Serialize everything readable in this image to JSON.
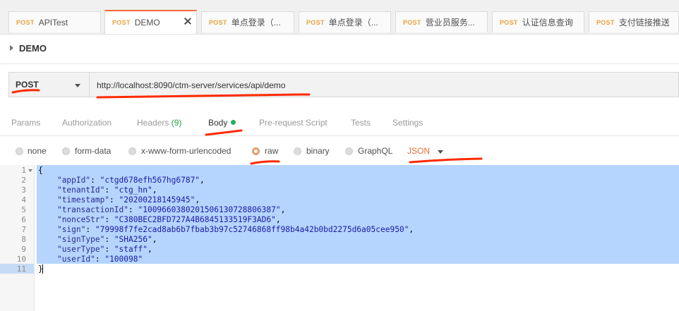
{
  "request_tabs": [
    {
      "method": "POST",
      "name": "APITest",
      "active": false
    },
    {
      "method": "POST",
      "name": "DEMO",
      "active": true
    },
    {
      "method": "POST",
      "name": "单点登录（...",
      "active": false
    },
    {
      "method": "POST",
      "name": "单点登录（...",
      "active": false
    },
    {
      "method": "POST",
      "name": "营业员服务...",
      "active": false
    },
    {
      "method": "POST",
      "name": "认证信息查询",
      "active": false
    },
    {
      "method": "POST",
      "name": "支付链接推送",
      "active": false
    }
  ],
  "breadcrumb": {
    "title": "DEMO"
  },
  "request": {
    "method": "POST",
    "url": "http://localhost:8090/ctm-server/services/api/demo"
  },
  "request_sub_tabs": [
    {
      "label": "Params"
    },
    {
      "label": "Authorization"
    },
    {
      "label": "Headers",
      "count": "(9)"
    },
    {
      "label": "Body",
      "active": true
    },
    {
      "label": "Pre-request Script"
    },
    {
      "label": "Tests"
    },
    {
      "label": "Settings"
    }
  ],
  "body_modes": [
    {
      "label": "none",
      "selected": false
    },
    {
      "label": "form-data",
      "selected": false
    },
    {
      "label": "x-www-form-urlencoded",
      "selected": false
    },
    {
      "label": "raw",
      "selected": true
    },
    {
      "label": "binary",
      "selected": false
    },
    {
      "label": "GraphQL",
      "selected": false
    }
  ],
  "body_format": "JSON",
  "editor": {
    "lines": [
      {
        "num": "1",
        "indent": "",
        "key": "",
        "value": "",
        "text": "{",
        "comma": false
      },
      {
        "num": "2",
        "indent": "    ",
        "key": "\"appId\"",
        "value": "\"ctgd678efh567hg6787\"",
        "comma": true
      },
      {
        "num": "3",
        "indent": "    ",
        "key": "\"tenantId\"",
        "value": "\"ctg_hn\"",
        "comma": true
      },
      {
        "num": "4",
        "indent": "    ",
        "key": "\"timestamp\"",
        "value": "\"20200218145945\"",
        "comma": true
      },
      {
        "num": "5",
        "indent": "    ",
        "key": "\"transactionId\"",
        "value": "\"1009660380201506130728806387\"",
        "comma": true
      },
      {
        "num": "6",
        "indent": "    ",
        "key": "\"nonceStr\"",
        "value": "\"C380BEC2BFD727A4B6845133519F3AD6\"",
        "comma": true
      },
      {
        "num": "7",
        "indent": "    ",
        "key": "\"sign\"",
        "value": "\"79998f7fe2cad8ab6b7fbab3b97c52746868ff98b4a42b0bd2275d6a05cee950\"",
        "comma": true
      },
      {
        "num": "8",
        "indent": "    ",
        "key": "\"signType\"",
        "value": "\"SHA256\"",
        "comma": true
      },
      {
        "num": "9",
        "indent": "    ",
        "key": "\"userType\"",
        "value": "\"staff\"",
        "comma": true
      },
      {
        "num": "10",
        "indent": "    ",
        "key": "\"userId\"",
        "value": "\"100098\"",
        "comma": false
      },
      {
        "num": "11",
        "indent": "",
        "key": "",
        "value": "",
        "text": "}",
        "comma": false
      }
    ]
  },
  "colors": {
    "accent": "#f26b3a",
    "annotation": "#ff2a00",
    "method_tag": "#e8a33d",
    "selection": "#b5d5ff",
    "body_dot": "#27ae60",
    "json_label": "#e8703a"
  }
}
